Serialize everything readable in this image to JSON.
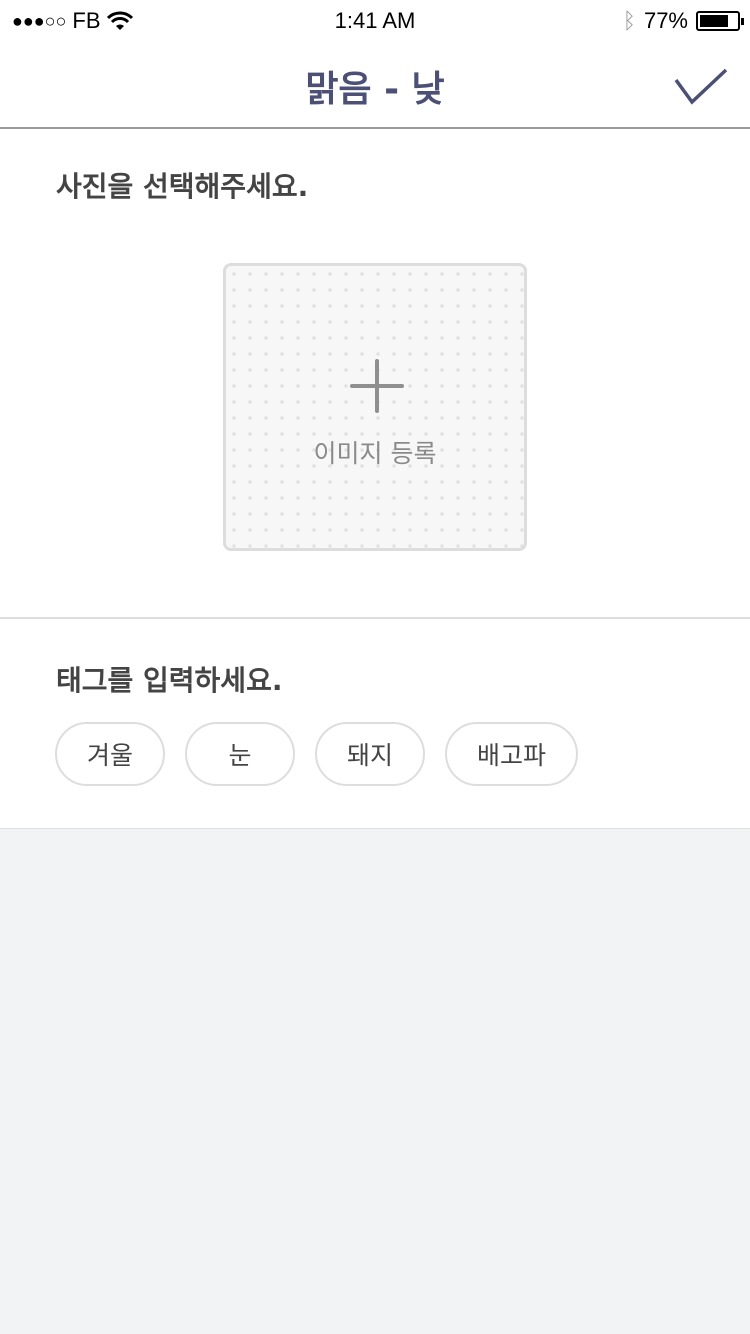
{
  "status": {
    "carrier": "FB",
    "signal": "●●●○○",
    "time": "1:41 AM",
    "battery": "77%",
    "battery_level": 0.77
  },
  "nav": {
    "title": "맑음 - 낮"
  },
  "photo": {
    "heading": "사진을 선택해주세요.",
    "add_label": "이미지 등록"
  },
  "tags": {
    "heading": "태그를 입력하세요.",
    "items": [
      "겨울",
      "눈",
      "돼지",
      "배고파"
    ]
  }
}
